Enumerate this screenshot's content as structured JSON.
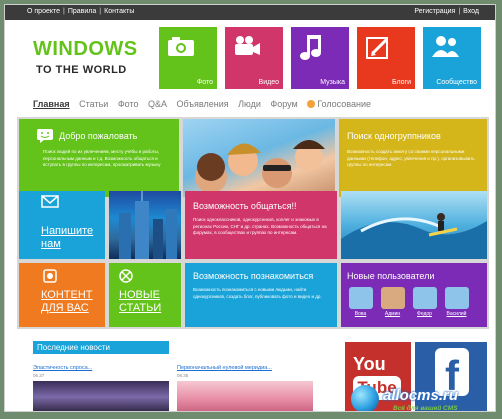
{
  "topbar": {
    "left_links": [
      "О проекте",
      "Правила",
      "Контакты"
    ],
    "right_links": [
      "Регистрация",
      "Вход"
    ]
  },
  "logo": {
    "line1": "WINDOWS",
    "line2": "TO THE WORLD"
  },
  "top_tiles": [
    {
      "label": "Фото",
      "icon": "camera-icon",
      "color": "#64c31a"
    },
    {
      "label": "Видео",
      "icon": "video-camera-icon",
      "color": "#d1366a"
    },
    {
      "label": "Музыка",
      "icon": "music-note-icon",
      "color": "#7b2bb5"
    },
    {
      "label": "Блоги",
      "icon": "blog-pen-icon",
      "color": "#e8391e"
    },
    {
      "label": "Сообщество",
      "icon": "community-icon",
      "color": "#1aa3d8"
    }
  ],
  "nav": {
    "items": [
      "Главная",
      "Статьи",
      "Фото",
      "Q&A",
      "Объявления",
      "Люди",
      "Форум",
      "Голосование"
    ]
  },
  "tiles": {
    "welcome": {
      "title": "Добро пожаловать",
      "desc": "Поиск людей по их увлечениям, месту учёбы и работы, персональным данным и т.д. Возможность общаться и вступать в группы по интересам, просматривать музыку",
      "icon": "chat-smile-icon",
      "color": "#64c31a"
    },
    "classmates": {
      "title": "Поиск одногруппников",
      "desc": "Возможность создать анкету со своими персональными данными (телефон, адрес, увлечения и пр.), организовывать группы по интересам.",
      "color": "#d4b51a"
    },
    "write": {
      "line1": "Напишите",
      "line2": "нам",
      "icon": "envelope-icon",
      "color": "#1aa3d8"
    },
    "communicate": {
      "title": "Возможность общаться!!",
      "desc": "Поиск одноклассников, однокурсников, коллег и знакомых в регионах России, СНГ и др. странах. Возможность общаться на форумах, в сообществах и группах по интересам.",
      "color": "#d1366a"
    },
    "content": {
      "line1": "КОНТЕНТ",
      "line2": "ДЛЯ ВАС",
      "icon": "content-icon",
      "color": "#f07a20"
    },
    "news_tile": {
      "line1": "НОВЫЕ",
      "line2": "СТАТЬИ",
      "icon": "xbox-icon",
      "color": "#64c31a"
    },
    "meet": {
      "title": "Возможность познакомиться",
      "desc": "Возможность познакомиться с новыми людьми, найти однокурсников, создать блог, публиковать фото и видео и др.",
      "color": "#1aa3d8"
    },
    "new_users": {
      "title": "Новые пользователи",
      "users": [
        "Вова",
        "Админ",
        "Федор",
        "Василий"
      ],
      "color": "#7b2bb5"
    }
  },
  "latest_news": {
    "header": "Последние новости",
    "items": [
      {
        "title": "Эластичность спроса...",
        "date": "06.37"
      },
      {
        "title": "Первоначальный нулевой меридиа...",
        "date": "06.35"
      }
    ]
  },
  "social": {
    "youtube_you": "You",
    "youtube_tube": "Tube",
    "facebook": "f"
  },
  "watermark": {
    "site": "allocms.ru",
    "tagline": "Всё для вашей CMS"
  }
}
